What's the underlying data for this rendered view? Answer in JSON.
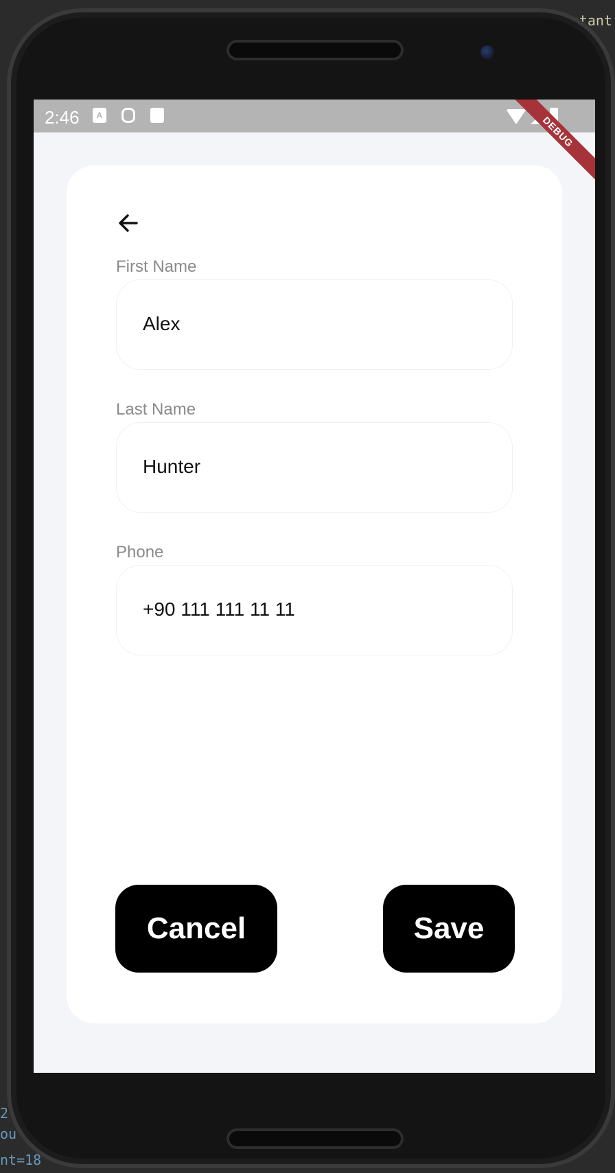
{
  "ide": {
    "top_right_fragment": "stant",
    "bottom_left_lines": [
      "2",
      "ou",
      "nt=18"
    ]
  },
  "status_bar": {
    "time": "2:46",
    "left_icons": [
      "keyboard-a-icon",
      "mouse-icon",
      "sd-card-icon"
    ],
    "right_icons": [
      "wifi-icon",
      "cell-signal-icon",
      "battery-icon"
    ],
    "debug_banner": "DEBUG"
  },
  "form": {
    "back_icon": "arrow-left-icon",
    "first_name": {
      "label": "First Name",
      "value": "Alex"
    },
    "last_name": {
      "label": "Last Name",
      "value": "Hunter"
    },
    "phone": {
      "label": "Phone",
      "value": "+90 111 111 11 11"
    }
  },
  "actions": {
    "cancel_label": "Cancel",
    "save_label": "Save"
  },
  "colors": {
    "screen_background": "#f4f5f9",
    "card_background": "#ffffff",
    "button_background": "#000000",
    "button_text": "#ffffff",
    "label_text": "#8a8a8a",
    "status_bar": "#b4b4b4",
    "debug_banner": "#a7333a"
  }
}
